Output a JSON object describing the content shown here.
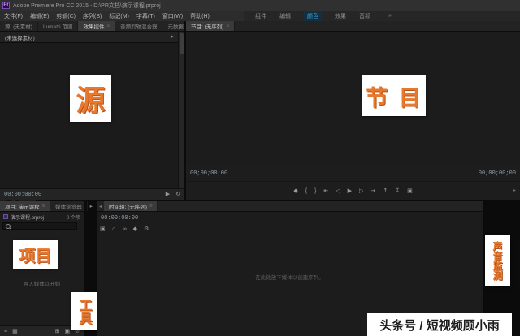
{
  "window": {
    "app_icon": "Pr",
    "title": "Adobe Premiere Pro CC 2015 - D:\\PR文档\\演示课程.prproj"
  },
  "menu_bar": {
    "items": [
      "文件(F)",
      "编辑(E)",
      "剪辑(C)",
      "序列(S)",
      "标记(M)",
      "字幕(T)",
      "窗口(W)",
      "帮助(H)"
    ]
  },
  "workspace_bar": {
    "tabs": [
      "组件",
      "编辑",
      "颜色",
      "效果",
      "音频"
    ],
    "active_index": 2,
    "overflow": "»"
  },
  "source_group": {
    "tabs": [
      {
        "label": "源: (无素材)"
      },
      {
        "label": "Lumetri 范围"
      },
      {
        "label": "效果控件",
        "active": true
      },
      {
        "label": "音频剪辑混合器"
      },
      {
        "label": "元数据"
      }
    ],
    "panel_menu_icon": "≡",
    "header": "(未选择素材)",
    "header_arrow": "▸",
    "timecode": "00:00:00:00",
    "bottom_icons": [
      {
        "name": "play-audio",
        "glyph": "▶"
      },
      {
        "name": "loop-playback",
        "glyph": "↻"
      }
    ]
  },
  "program": {
    "tab": "节目: (无序列)",
    "panel_menu_icon": "≡",
    "timecode_left": "00;00;00;00",
    "timecode_right": "00;00;00;00",
    "transport": [
      {
        "name": "add-marker",
        "glyph": "◆"
      },
      {
        "name": "mark-in",
        "glyph": "{"
      },
      {
        "name": "mark-out",
        "glyph": "}"
      },
      {
        "name": "go-to-in",
        "glyph": "⇤"
      },
      {
        "name": "step-back",
        "glyph": "◁"
      },
      {
        "name": "play",
        "glyph": "▶"
      },
      {
        "name": "step-forward",
        "glyph": "▷"
      },
      {
        "name": "go-to-out",
        "glyph": "⇥"
      },
      {
        "name": "lift",
        "glyph": "↥"
      },
      {
        "name": "extract",
        "glyph": "↧"
      },
      {
        "name": "export-frame",
        "glyph": "▣"
      }
    ],
    "button_editor": "+"
  },
  "project": {
    "tab_active": "项目: 演示课程",
    "tab_inactive": "媒体浏览器",
    "panel_menu_icon": "≡",
    "overflow": "▸",
    "file_name": "演示课程.prproj",
    "item_count": "0 个项",
    "empty_text": "导入媒体以开始",
    "footer_icons": [
      {
        "name": "list-view",
        "glyph": "≡"
      },
      {
        "name": "icon-view",
        "glyph": "▦"
      },
      {
        "name": "new-bin",
        "glyph": "⊞"
      },
      {
        "name": "new-item",
        "glyph": "▣"
      },
      {
        "name": "delete-item",
        "glyph": "⊘"
      }
    ]
  },
  "tools": {
    "items": [
      {
        "name": "selection-tool",
        "glyph": "➤"
      },
      {
        "name": "track-select-tool",
        "glyph": "⇥"
      },
      {
        "name": "ripple-edit-tool",
        "glyph": "⇹"
      },
      {
        "name": "razor-tool",
        "glyph": "✂"
      },
      {
        "name": "slip-tool",
        "glyph": "⇆"
      },
      {
        "name": "pen-tool",
        "glyph": "✎"
      },
      {
        "name": "hand-tool",
        "glyph": "☞"
      },
      {
        "name": "zoom-tool",
        "glyph": "◎"
      }
    ]
  },
  "timeline": {
    "collapse_arrow": "◂",
    "tab": "时间轴: (无序列)",
    "panel_menu_icon": "≡",
    "timecode": "00:00:00:00",
    "icons": [
      {
        "name": "nest-toggle",
        "glyph": "▣"
      },
      {
        "name": "snap-toggle",
        "glyph": "∩"
      },
      {
        "name": "linked-selection-toggle",
        "glyph": "∞"
      },
      {
        "name": "add-marker",
        "glyph": "◆"
      },
      {
        "name": "timeline-settings",
        "glyph": "⚙"
      }
    ],
    "drop_text": "在此处放下媒体以创建序列。"
  },
  "overlays": {
    "source": "源",
    "program": "节 目",
    "project": "项目",
    "tools": "工具",
    "audio_meter": "声音监测",
    "accent_color": "#e8782c"
  },
  "watermark": {
    "text": "头条号 / 短视频顾小雨"
  },
  "colors": {
    "workspace_active": "#3fa0da",
    "panel_bg": "#1d1d1d",
    "chrome_bg": "#2c2c2c"
  }
}
